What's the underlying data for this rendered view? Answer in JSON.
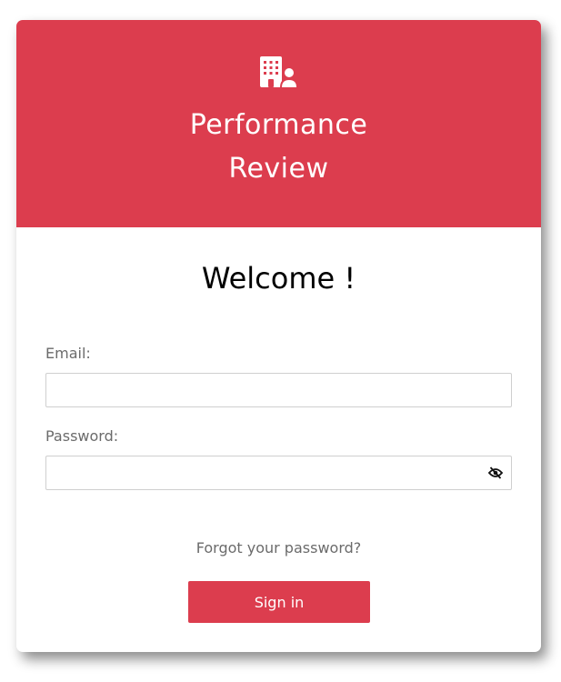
{
  "header": {
    "title_line1": "Performance",
    "title_line2": "Review",
    "logo_icon": "building-user-icon",
    "background_color": "#dc3d4e"
  },
  "form": {
    "welcome": "Welcome !",
    "email_label": "Email:",
    "email_value": "",
    "password_label": "Password:",
    "password_value": "",
    "password_toggle_icon": "eye-slash-icon",
    "forgot_password": "Forgot your password?",
    "signin_label": "Sign in",
    "accent_color": "#dc3d4e"
  }
}
